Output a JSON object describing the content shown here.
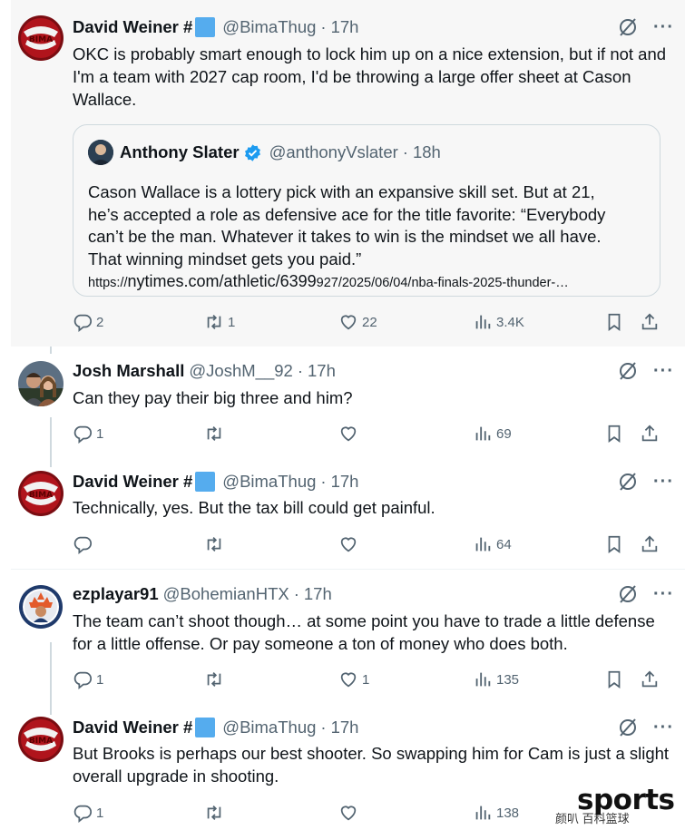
{
  "posts": [
    {
      "name": "David Weiner #",
      "handle": "@BimaThug",
      "dot": "·",
      "time": "17h",
      "text": "OKC is probably smart enough to lock him up on a nice extension, but if not and I'm a team with 2027 cap room, I'd be throwing a large offer sheet at Cason Wallace.",
      "quote": {
        "name": "Anthony Slater",
        "handle": "@anthonyVslater",
        "dot": "·",
        "time": "18h",
        "lines": [
          "Cason Wallace is a lottery pick with an expansive skill set. But at 21,",
          "he’s accepted a role as defensive ace for the title favorite: “Everybody",
          "can’t be the man. Whatever it takes to win is the mindset we all have.",
          "That winning mindset gets you paid.”"
        ],
        "link_prefix": "https://",
        "link_main": "nytimes.com/athletic/6399",
        "link_rest": "927/2025/06/04/nba-finals-2025-thunder-…"
      },
      "replies": "2",
      "reposts": "1",
      "likes": "22",
      "views": "3.4K"
    },
    {
      "name": "Josh Marshall",
      "handle": "@JoshM__92",
      "dot": "·",
      "time": "17h",
      "text": "Can they pay their big three and him?",
      "replies": "1",
      "reposts": "",
      "likes": "",
      "views": "69"
    },
    {
      "name": "David Weiner #",
      "handle": "@BimaThug",
      "dot": "·",
      "time": "17h",
      "text": "Technically, yes. But the tax bill could get painful.",
      "replies": "",
      "reposts": "",
      "likes": "",
      "views": "64"
    },
    {
      "name": "ezplayar91",
      "handle": "@BohemianHTX",
      "dot": "·",
      "time": "17h",
      "text": "The team can’t shoot though… at some point you have to trade a little defense for a little offense. Or pay someone a ton of money who does both.",
      "replies": "1",
      "reposts": "",
      "likes": "1",
      "views": "135"
    },
    {
      "name": "David Weiner #",
      "handle": "@BimaThug",
      "dot": "·",
      "time": "17h",
      "text": "But Brooks is perhaps our best shooter. So swapping him for Cam is just a slight overall upgrade in shooting.",
      "replies": "1",
      "reposts": "",
      "likes": "",
      "views": "138"
    }
  ],
  "watermark": {
    "big": "sports",
    "small": "颜叭 百科篮球"
  },
  "colors": {
    "text": "#0f1419",
    "secondary": "#536471",
    "verified": "#1d9bf0",
    "flag": "#55acee",
    "highlight_bg": "#f7f7f7",
    "thread_line": "#cfd9de"
  },
  "icons": [
    "reply-icon",
    "repost-icon",
    "like-icon",
    "views-icon",
    "bookmark-icon",
    "share-icon",
    "grok-icon",
    "more-icon",
    "verified-icon"
  ]
}
